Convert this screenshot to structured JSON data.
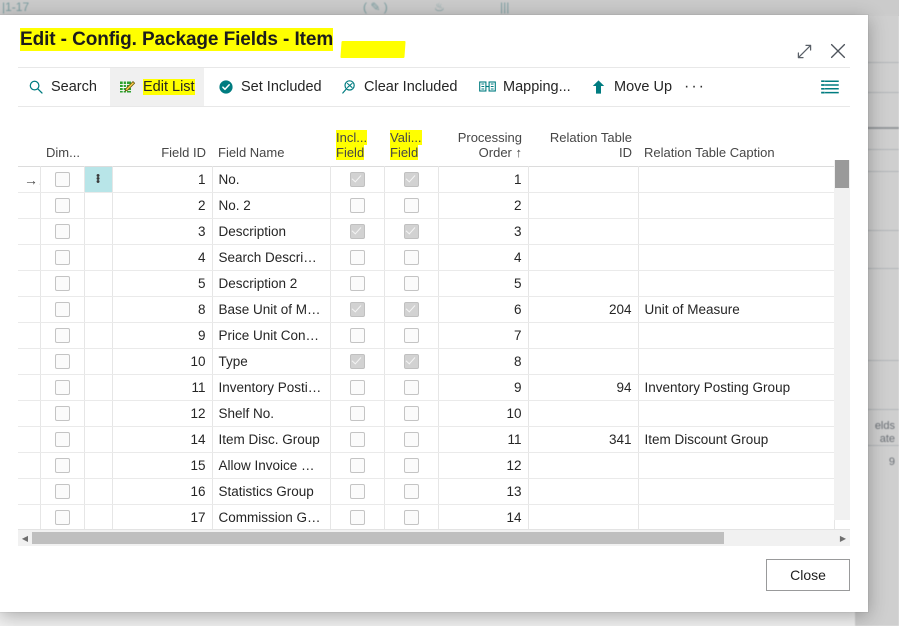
{
  "background": {
    "right_pane_lines": [
      "elds",
      "ate",
      "9"
    ]
  },
  "dialog": {
    "title": "Edit - Config. Package Fields - Item",
    "expand_icon": "expand-icon",
    "close_icon": "close-icon"
  },
  "commandbar": {
    "items": [
      {
        "label": "Search",
        "icon": "search-icon",
        "active": false,
        "highlighted": false
      },
      {
        "label": "Edit List",
        "icon": "edit-list-icon",
        "active": true,
        "highlighted": true
      },
      {
        "label": "Set Included",
        "icon": "check-circle-icon",
        "active": false,
        "highlighted": false
      },
      {
        "label": "Clear Included",
        "icon": "clear-pin-icon",
        "active": false,
        "highlighted": false
      },
      {
        "label": "Mapping...",
        "icon": "mapping-icon",
        "active": false,
        "highlighted": false
      },
      {
        "label": "Move Up",
        "icon": "arrow-up-icon",
        "active": false,
        "highlighted": false
      }
    ],
    "overflow_label": "···",
    "list_view_icon": "list-view-icon"
  },
  "grid": {
    "columns": [
      {
        "key": "arrow",
        "label": "",
        "align": "c",
        "highlighted": false
      },
      {
        "key": "dim",
        "label": "Dim...",
        "align": "c",
        "highlighted": false
      },
      {
        "key": "dots",
        "label": "",
        "align": "c",
        "highlighted": false
      },
      {
        "key": "field_id",
        "label": "Field ID",
        "align": "r",
        "highlighted": false
      },
      {
        "key": "field_name",
        "label": "Field Name",
        "align": "l",
        "highlighted": false
      },
      {
        "key": "incl",
        "label": "Incl... Field",
        "align": "c",
        "highlighted": true
      },
      {
        "key": "vali",
        "label": "Vali... Field",
        "align": "c",
        "highlighted": true
      },
      {
        "key": "proc",
        "label": "Processing Order ↑",
        "align": "r",
        "highlighted": false
      },
      {
        "key": "rel_id",
        "label": "Relation Table ID",
        "align": "r",
        "highlighted": false
      },
      {
        "key": "rel_cap",
        "label": "Relation Table Caption",
        "align": "l",
        "highlighted": false
      }
    ],
    "header_lines": {
      "dim": [
        "",
        "Dim..."
      ],
      "field_id": [
        "",
        "Field ID"
      ],
      "field_name": [
        "",
        "Field Name"
      ],
      "incl": [
        "Incl...",
        "Field"
      ],
      "vali": [
        "Vali...",
        "Field"
      ],
      "proc": [
        "Processing",
        "Order ↑"
      ],
      "rel_id": [
        "Relation Table",
        "ID"
      ],
      "rel_cap": [
        "",
        "Relation Table Caption"
      ]
    },
    "rows": [
      {
        "selected": true,
        "dim": false,
        "field_id": "1",
        "field_name": "No.",
        "incl": true,
        "vali": true,
        "proc": "1",
        "rel_id": "",
        "rel_cap": ""
      },
      {
        "selected": false,
        "dim": false,
        "field_id": "2",
        "field_name": "No. 2",
        "incl": false,
        "vali": false,
        "proc": "2",
        "rel_id": "",
        "rel_cap": ""
      },
      {
        "selected": false,
        "dim": false,
        "field_id": "3",
        "field_name": "Description",
        "incl": true,
        "vali": true,
        "proc": "3",
        "rel_id": "",
        "rel_cap": ""
      },
      {
        "selected": false,
        "dim": false,
        "field_id": "4",
        "field_name": "Search Descripti...",
        "incl": false,
        "vali": false,
        "proc": "4",
        "rel_id": "",
        "rel_cap": ""
      },
      {
        "selected": false,
        "dim": false,
        "field_id": "5",
        "field_name": "Description 2",
        "incl": false,
        "vali": false,
        "proc": "5",
        "rel_id": "",
        "rel_cap": ""
      },
      {
        "selected": false,
        "dim": false,
        "field_id": "8",
        "field_name": "Base Unit of Me...",
        "incl": true,
        "vali": true,
        "proc": "6",
        "rel_id": "204",
        "rel_cap": "Unit of Measure"
      },
      {
        "selected": false,
        "dim": false,
        "field_id": "9",
        "field_name": "Price Unit Conve...",
        "incl": false,
        "vali": false,
        "proc": "7",
        "rel_id": "",
        "rel_cap": ""
      },
      {
        "selected": false,
        "dim": false,
        "field_id": "10",
        "field_name": "Type",
        "incl": true,
        "vali": true,
        "proc": "8",
        "rel_id": "",
        "rel_cap": ""
      },
      {
        "selected": false,
        "dim": false,
        "field_id": "11",
        "field_name": "Inventory Postin...",
        "incl": false,
        "vali": false,
        "proc": "9",
        "rel_id": "94",
        "rel_cap": "Inventory Posting Group"
      },
      {
        "selected": false,
        "dim": false,
        "field_id": "12",
        "field_name": "Shelf No.",
        "incl": false,
        "vali": false,
        "proc": "10",
        "rel_id": "",
        "rel_cap": ""
      },
      {
        "selected": false,
        "dim": false,
        "field_id": "14",
        "field_name": "Item Disc. Group",
        "incl": false,
        "vali": false,
        "proc": "11",
        "rel_id": "341",
        "rel_cap": "Item Discount Group"
      },
      {
        "selected": false,
        "dim": false,
        "field_id": "15",
        "field_name": "Allow Invoice Disc.",
        "incl": false,
        "vali": false,
        "proc": "12",
        "rel_id": "",
        "rel_cap": ""
      },
      {
        "selected": false,
        "dim": false,
        "field_id": "16",
        "field_name": "Statistics Group",
        "incl": false,
        "vali": false,
        "proc": "13",
        "rel_id": "",
        "rel_cap": ""
      },
      {
        "selected": false,
        "dim": false,
        "field_id": "17",
        "field_name": "Commission Gro...",
        "incl": false,
        "vali": false,
        "proc": "14",
        "rel_id": "",
        "rel_cap": ""
      }
    ]
  },
  "footer": {
    "close_label": "Close"
  },
  "colors": {
    "accent": "#007c80",
    "highlight": "#ffff00",
    "selection": "#b8e5e8"
  }
}
